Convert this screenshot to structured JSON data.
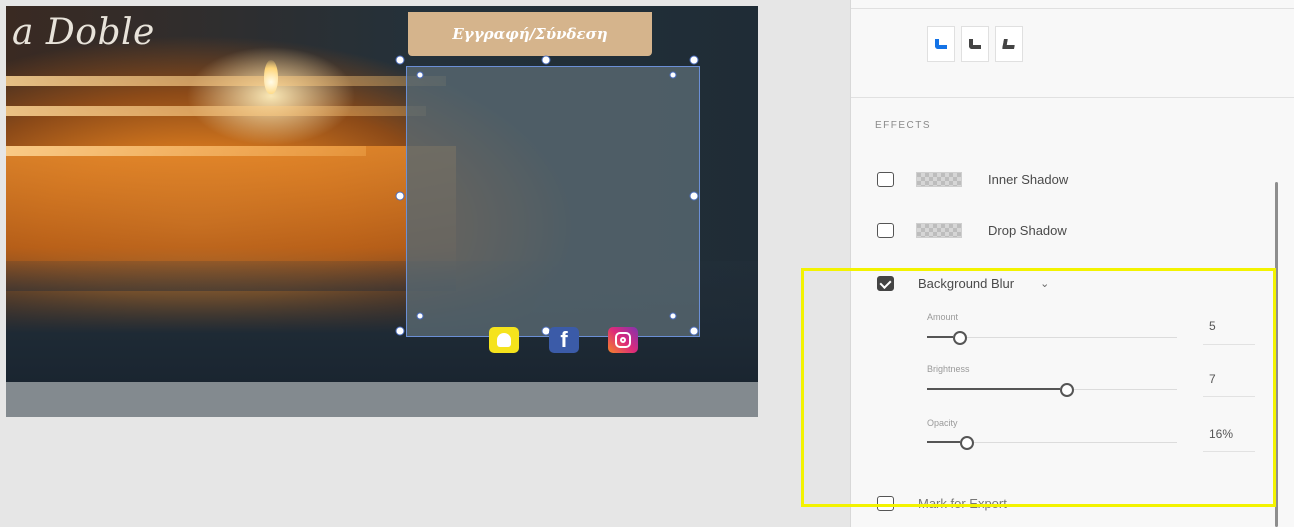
{
  "canvas": {
    "hero_title": "a Doble",
    "signup_button": "Εγγραφή/Σύνδεση",
    "social": [
      {
        "name": "snapchat-icon",
        "glyph": ""
      },
      {
        "name": "facebook-icon",
        "glyph": "f"
      },
      {
        "name": "instagram-icon",
        "glyph": ""
      }
    ]
  },
  "panel": {
    "corner_options": [
      {
        "name": "corner-style-rounded",
        "active": true
      },
      {
        "name": "corner-style-round-alt",
        "active": false
      },
      {
        "name": "corner-style-chamfer",
        "active": false
      }
    ],
    "effects_title": "EFFECTS",
    "inner_shadow": {
      "label": "Inner Shadow",
      "checked": false
    },
    "drop_shadow": {
      "label": "Drop Shadow",
      "checked": false
    },
    "background_blur": {
      "label": "Background Blur",
      "checked": true,
      "chevron": "⌄",
      "amount": {
        "label": "Amount",
        "value": "5",
        "fraction": 0.13
      },
      "brightness": {
        "label": "Brightness",
        "value": "7",
        "fraction": 0.56
      },
      "opacity": {
        "label": "Opacity",
        "value": "16%",
        "fraction": 0.16
      }
    },
    "export": {
      "label": "Mark for Export",
      "checked": false
    }
  },
  "colors": {
    "accent": "#1473e6",
    "highlight": "#f3f300",
    "signup_bg": "#d5b48c"
  }
}
